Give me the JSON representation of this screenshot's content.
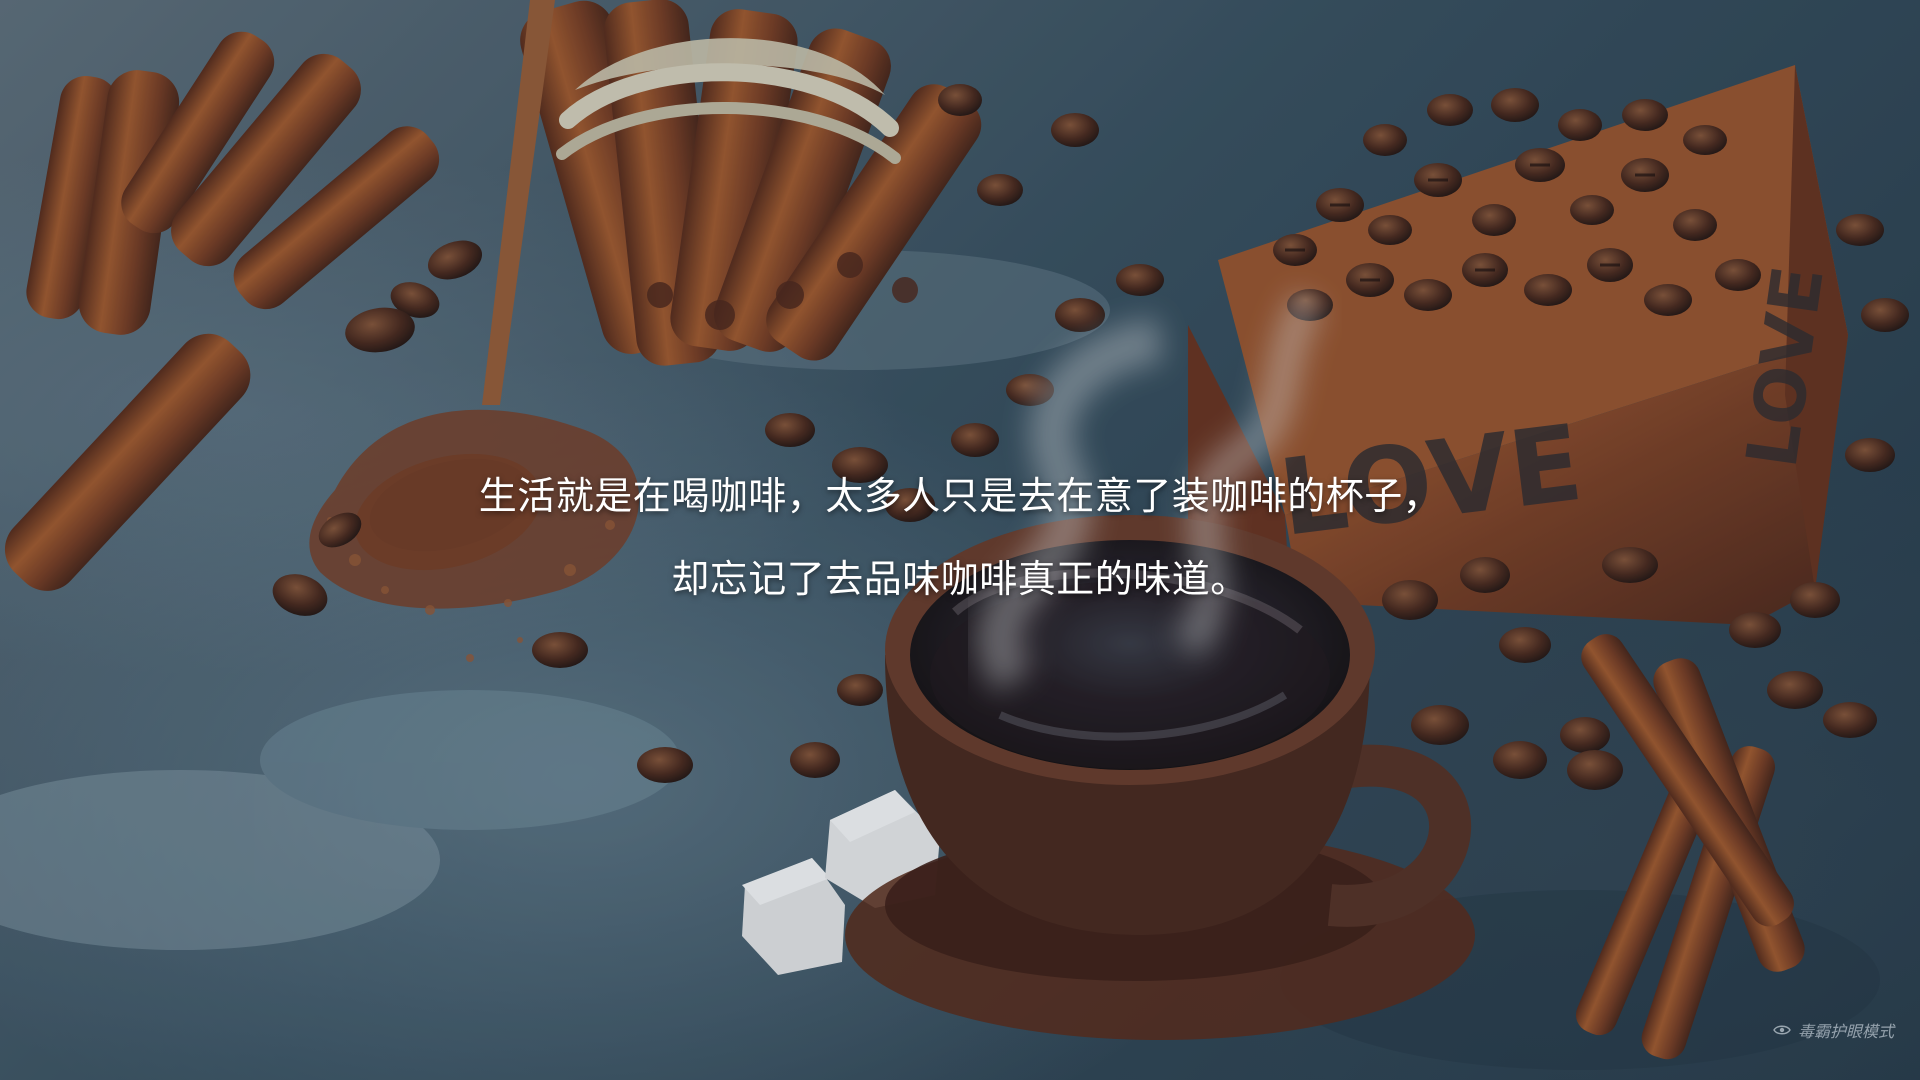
{
  "caption": {
    "line1": "生活就是在喝咖啡，太多人只是去在意了装咖啡的杯子，",
    "line2": "却忘记了去品味咖啡真正的味道。"
  },
  "crate": {
    "front_text": "LOVE",
    "side_text": "LOVE"
  },
  "watermark": {
    "text": "毒霸护眼模式",
    "icon": "eye-icon"
  },
  "colors": {
    "surface": "#3c505d",
    "coffee": "#2a1610",
    "cup": "#4a2a1d",
    "cinnamon": "#8a4a27",
    "crate": "#8b4a27"
  }
}
